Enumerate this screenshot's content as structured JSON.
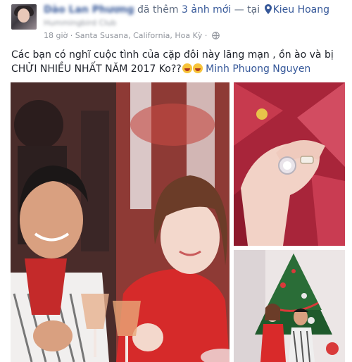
{
  "header": {
    "author": "Dào Lan Phương",
    "added_text": "đã thêm",
    "photo_count_text": "3 ảnh mới",
    "at_text": "— tại",
    "place": "Kieu Hoang",
    "sub_text": "Hummingbird Club",
    "meta_text": "18 giờ · Santa Susana, California, Hoa Kỳ ·",
    "pin_icon": "location-pin-icon",
    "globe_icon": "globe-icon"
  },
  "post": {
    "text": "Các bạn có nghĩ cuộc tình của cặp đôi này lãng mạn , ồn ào và bị CHỬI NHIỀU NHẤT NĂM 2017 Ko??",
    "mention": "Minh Phuong Nguyen"
  },
  "colors": {
    "link": "#365899",
    "muted": "#90949c",
    "text": "#1d2129"
  }
}
